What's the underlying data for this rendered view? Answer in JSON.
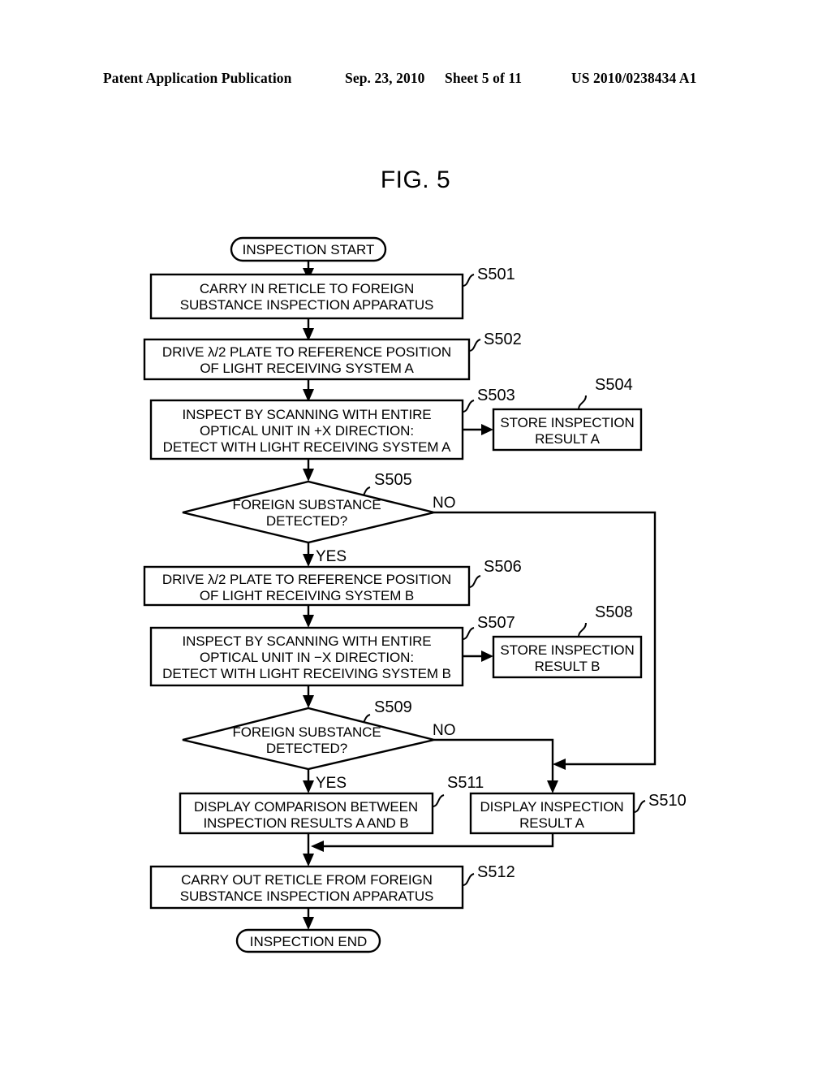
{
  "header": {
    "publication": "Patent Application Publication",
    "date": "Sep. 23, 2010",
    "sheet": "Sheet 5 of 11",
    "number": "US 2010/0238434 A1"
  },
  "figure": {
    "title": "FIG. 5"
  },
  "nodes": {
    "start": {
      "label": "INSPECTION START"
    },
    "end": {
      "label": "INSPECTION END"
    },
    "s501": {
      "step": "S501",
      "lines": [
        "CARRY IN RETICLE TO FOREIGN",
        "SUBSTANCE INSPECTION APPARATUS"
      ]
    },
    "s502": {
      "step": "S502",
      "lines": [
        "DRIVE λ/2 PLATE TO REFERENCE POSITION",
        "OF LIGHT RECEIVING SYSTEM A"
      ]
    },
    "s503": {
      "step": "S503",
      "lines": [
        "INSPECT BY SCANNING WITH ENTIRE",
        "OPTICAL UNIT IN +X DIRECTION:",
        "DETECT WITH LIGHT RECEIVING SYSTEM A"
      ]
    },
    "s504": {
      "step": "S504",
      "lines": [
        "STORE INSPECTION",
        "RESULT A"
      ]
    },
    "s505": {
      "step": "S505",
      "lines": [
        "FOREIGN SUBSTANCE",
        "DETECTED?"
      ],
      "yes": "YES",
      "no": "NO"
    },
    "s506": {
      "step": "S506",
      "lines": [
        "DRIVE λ/2 PLATE TO REFERENCE POSITION",
        "OF LIGHT RECEIVING SYSTEM B"
      ]
    },
    "s507": {
      "step": "S507",
      "lines": [
        "INSPECT BY SCANNING WITH ENTIRE",
        "OPTICAL UNIT IN −X DIRECTION:",
        "DETECT WITH LIGHT RECEIVING SYSTEM B"
      ]
    },
    "s508": {
      "step": "S508",
      "lines": [
        "STORE INSPECTION",
        "RESULT B"
      ]
    },
    "s509": {
      "step": "S509",
      "lines": [
        "FOREIGN SUBSTANCE",
        "DETECTED?"
      ],
      "yes": "YES",
      "no": "NO"
    },
    "s510": {
      "step": "S510",
      "lines": [
        "DISPLAY INSPECTION",
        "RESULT A"
      ]
    },
    "s511": {
      "step": "S511",
      "lines": [
        "DISPLAY COMPARISON BETWEEN",
        "INSPECTION RESULTS A AND B"
      ]
    },
    "s512": {
      "step": "S512",
      "lines": [
        "CARRY OUT RETICLE FROM FOREIGN",
        "SUBSTANCE INSPECTION APPARATUS"
      ]
    }
  },
  "colors": {
    "ink": "#000000",
    "paper": "#ffffff"
  }
}
